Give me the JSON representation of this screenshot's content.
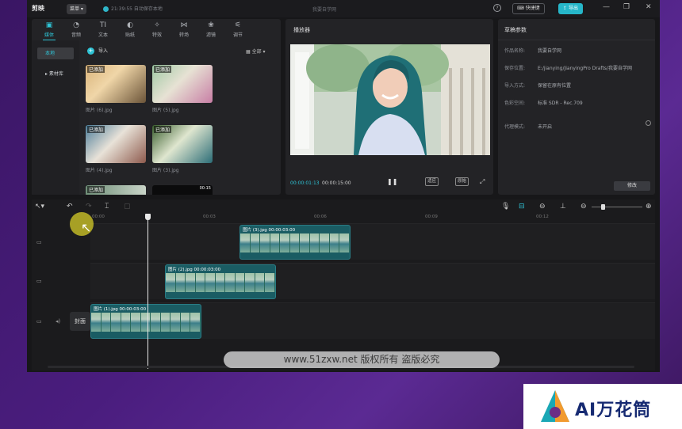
{
  "app": {
    "logo": "剪映",
    "menu": "菜单",
    "save_status": "21:39:55 自动保存本地",
    "doc_title": "我要自学网",
    "shortcut": "快捷键",
    "export": "导出"
  },
  "toolbar": {
    "tabs": [
      {
        "label": "媒体",
        "icon": "media-icon"
      },
      {
        "label": "音频",
        "icon": "audio-icon"
      },
      {
        "label": "文本",
        "icon": "text-icon"
      },
      {
        "label": "贴纸",
        "icon": "sticker-icon"
      },
      {
        "label": "特效",
        "icon": "effects-icon"
      },
      {
        "label": "转场",
        "icon": "transition-icon"
      },
      {
        "label": "滤镜",
        "icon": "filter-icon"
      },
      {
        "label": "调节",
        "icon": "adjust-icon"
      }
    ]
  },
  "media": {
    "sidebar": [
      "本地",
      "素材库"
    ],
    "import": "导入",
    "sort": "全部",
    "items": [
      {
        "tag": "已添加",
        "name": "图片 (6).jpg"
      },
      {
        "tag": "已添加",
        "name": "图片 (5).jpg"
      },
      {
        "tag": "已添加",
        "name": "图片 (4).jpg"
      },
      {
        "tag": "已添加",
        "name": "图片 (3).jpg"
      },
      {
        "tag": "已添加",
        "name": ""
      },
      {
        "tag": "",
        "name": "",
        "dur": "00:15"
      }
    ]
  },
  "player": {
    "title": "播放器",
    "current": "00:00:01:13",
    "total": "00:00:15:00",
    "ratio_btn": "适应",
    "orig_btn": "原始"
  },
  "draft": {
    "title": "草稿参数",
    "rows": [
      {
        "k": "作品名称:",
        "v": "我要自学网"
      },
      {
        "k": "保存位置:",
        "v": "E:/jianying/JianyingPro Drafts/我要自学网"
      },
      {
        "k": "导入方式:",
        "v": "保留在原有位置"
      },
      {
        "k": "色彩空间:",
        "v": "标准 SDR - Rec.709"
      },
      {
        "k": "代理模式:",
        "v": "未开启"
      }
    ],
    "edit": "修改"
  },
  "timeline": {
    "ruler": [
      "00:00",
      "00:03",
      "00:06",
      "00:09",
      "00:12"
    ],
    "cover": "封面",
    "clips": [
      {
        "label": "图片 (3).jpg  00:00:03:00"
      },
      {
        "label": "图片 (2).jpg  00:00:03:00"
      },
      {
        "label": "图片 (1).jpg  00:00:03:00"
      }
    ]
  },
  "watermark": "www.51zxw.net 版权所有 盗版必究",
  "brand": "AI万花筒"
}
